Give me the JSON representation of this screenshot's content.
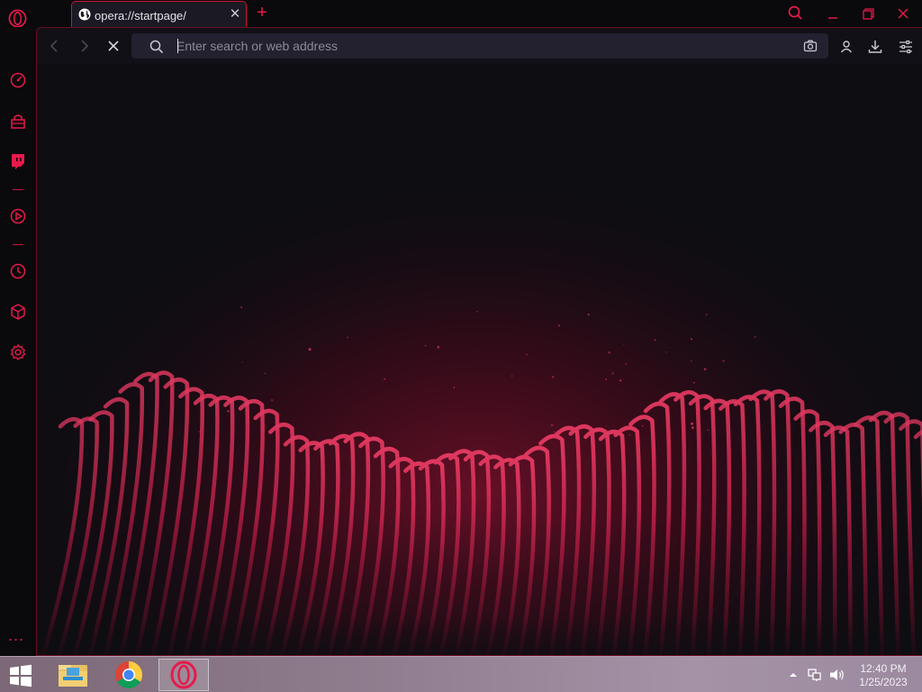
{
  "tab": {
    "title": "opera://startpage/",
    "close_glyph": "✕",
    "new_tab_glyph": "+"
  },
  "address_bar": {
    "placeholder": "Enter search or web address",
    "value": ""
  },
  "sidebar": {
    "items": [
      {
        "icon": "speed-dial-icon"
      },
      {
        "icon": "shopping-bag-icon"
      },
      {
        "icon": "twitch-icon"
      },
      {
        "icon": "player-icon"
      },
      {
        "icon": "history-icon"
      },
      {
        "icon": "extensions-cube-icon"
      },
      {
        "icon": "settings-gear-icon"
      }
    ],
    "more_glyph": "..."
  },
  "toolbar_icons": [
    "back-icon",
    "forward-icon",
    "stop-loading-icon",
    "search-icon",
    "camera-icon",
    "profile-icon",
    "download-icon",
    "easy-setup-icon"
  ],
  "taskbar": {
    "apps": [
      "file-explorer-icon",
      "chrome-icon",
      "opera-icon"
    ],
    "time": "12:40 PM",
    "date": "1/25/2023"
  },
  "colors": {
    "accent": "#e8194b",
    "background": "#0b0a0e",
    "wave": "#c8204e"
  }
}
